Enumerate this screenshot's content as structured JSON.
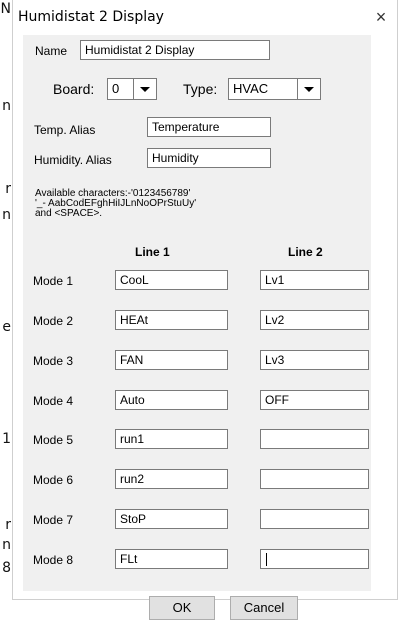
{
  "window": {
    "title": "Humidistat 2 Display",
    "close_glyph": "×"
  },
  "background_letters": [
    "N",
    "n",
    "r",
    "n",
    "e",
    "1",
    "r",
    "n",
    "8"
  ],
  "form": {
    "name_label": "Name",
    "name_value": "Humidistat 2 Display",
    "board_label": "Board:",
    "board_value": "0",
    "type_label": "Type:",
    "type_value": "HVAC",
    "temp_alias_label": "Temp. Alias",
    "temp_alias_value": "Temperature",
    "humidity_alias_label": "Humidity. Alias",
    "humidity_alias_value": "Humidity",
    "available_text": "Available characters:-'0123456789'\n'_- AabCodEFghHiIJLnNoOPrStuUy'\nand <SPACE>."
  },
  "table": {
    "col1_header": "Line 1",
    "col2_header": "Line 2",
    "rows": [
      {
        "label": "Mode 1",
        "line1": "CooL",
        "line2": "Lv1"
      },
      {
        "label": "Mode 2",
        "line1": "HEAt",
        "line2": "Lv2"
      },
      {
        "label": "Mode 3",
        "line1": "FAN",
        "line2": "Lv3"
      },
      {
        "label": "Mode 4",
        "line1": "Auto",
        "line2": "OFF"
      },
      {
        "label": "Mode 5",
        "line1": "run1",
        "line2": ""
      },
      {
        "label": "Mode 6",
        "line1": "run2",
        "line2": ""
      },
      {
        "label": "Mode 7",
        "line1": "StoP",
        "line2": ""
      },
      {
        "label": "Mode 8",
        "line1": "FLt",
        "line2": ""
      }
    ]
  },
  "buttons": {
    "ok": "OK",
    "cancel": "Cancel"
  }
}
